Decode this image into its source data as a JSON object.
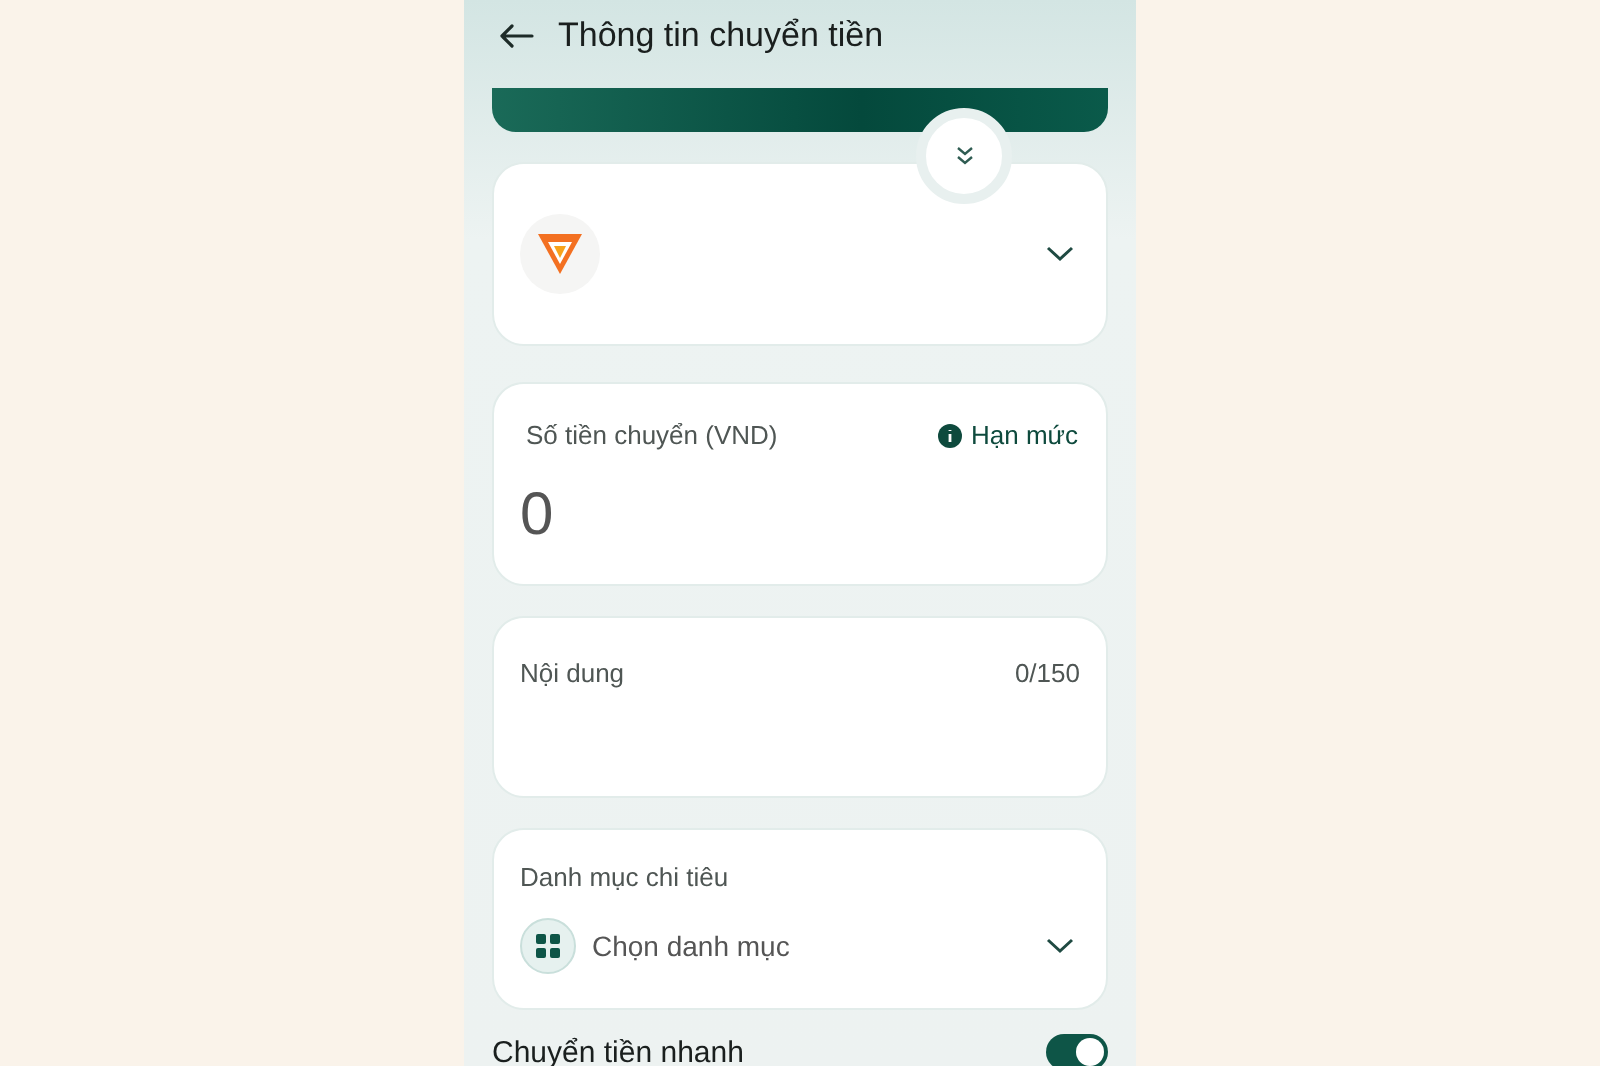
{
  "header": {
    "title": "Thông tin chuyển tiền"
  },
  "amount": {
    "label": "Số tiền chuyển (VND)",
    "limit_link": "Hạn mức",
    "value": "0"
  },
  "note": {
    "label": "Nội dung",
    "counter": "0/150"
  },
  "category": {
    "label": "Danh mục chi tiêu",
    "placeholder": "Chọn danh mục"
  },
  "quick_transfer": {
    "label": "Chuyển tiền nhanh",
    "on": true
  }
}
